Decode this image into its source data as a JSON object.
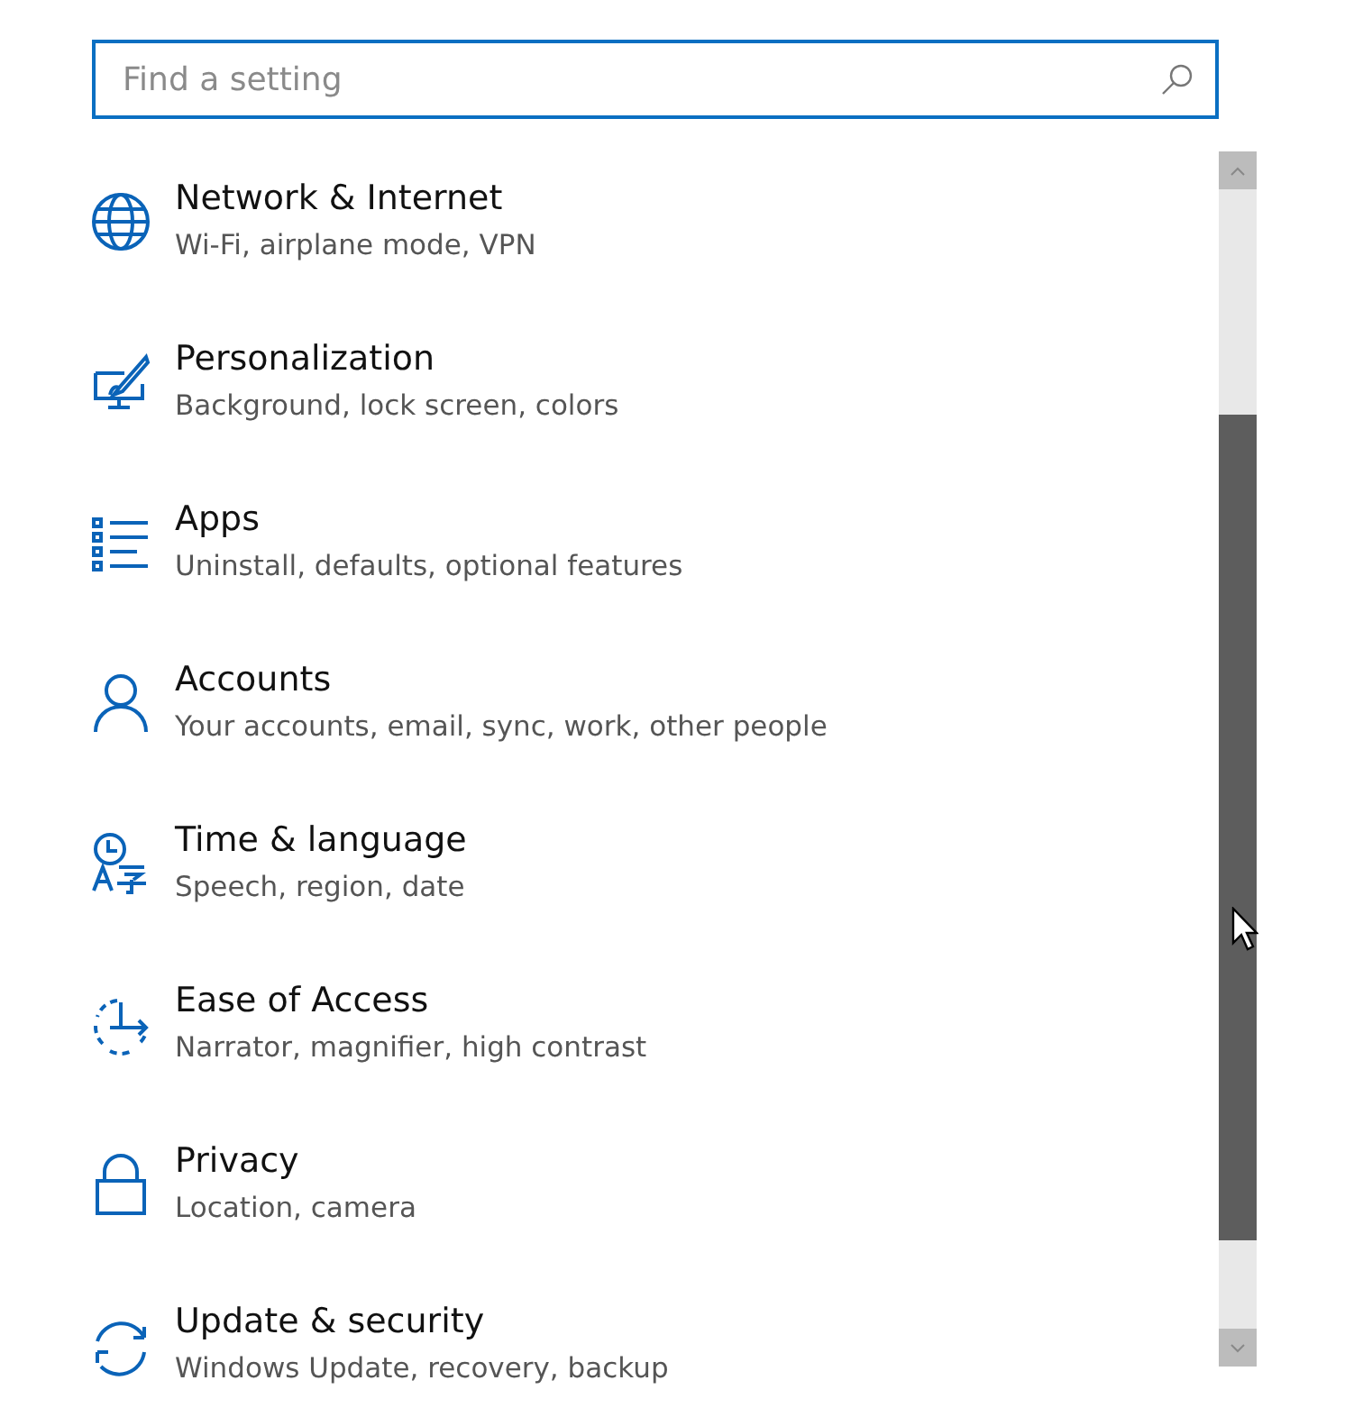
{
  "search": {
    "placeholder": "Find a setting"
  },
  "items": [
    {
      "kind": "globe",
      "title": "Network & Internet",
      "subtitle": "Wi-Fi, airplane mode, VPN"
    },
    {
      "kind": "personalize",
      "title": "Personalization",
      "subtitle": "Background, lock screen, colors"
    },
    {
      "kind": "list",
      "title": "Apps",
      "subtitle": "Uninstall, defaults, optional features"
    },
    {
      "kind": "person",
      "title": "Accounts",
      "subtitle": "Your accounts, email, sync, work, other people"
    },
    {
      "kind": "time",
      "title": "Time & language",
      "subtitle": "Speech, region, date"
    },
    {
      "kind": "ease",
      "title": "Ease of Access",
      "subtitle": "Narrator, magnifier, high contrast"
    },
    {
      "kind": "lock",
      "title": "Privacy",
      "subtitle": "Location, camera"
    },
    {
      "kind": "update",
      "title": "Update & security",
      "subtitle": "Windows Update, recovery, backup"
    }
  ]
}
